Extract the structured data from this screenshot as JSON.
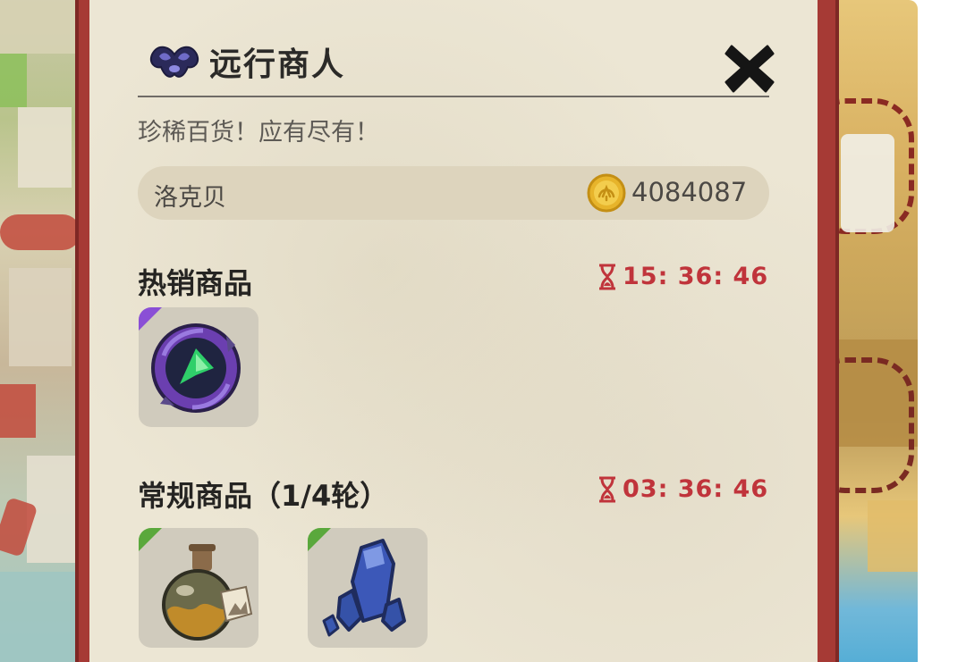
{
  "shop": {
    "title": "远行商人",
    "subtitle": "珍稀百货！应有尽有！",
    "currency": {
      "name": "洛克贝",
      "amount": "4084087",
      "icon": "coin-icon"
    },
    "close_icon": "close-icon"
  },
  "sections": {
    "hot": {
      "title": "热销商品",
      "timer": "15: 36: 46",
      "items": [
        {
          "icon": "purple-orb-icon",
          "rarity_color": "#8a4fd6"
        }
      ]
    },
    "regular": {
      "title": "常规商品（1/4轮）",
      "timer": "03: 36: 46",
      "items": [
        {
          "icon": "potion-bottle-icon",
          "rarity_color": "#5aa83c"
        },
        {
          "icon": "blue-crystal-icon",
          "rarity_color": "#5aa83c"
        }
      ]
    }
  },
  "colors": {
    "panel_frame": "#a63a35",
    "panel_bg": "#ece6d4",
    "timer_red": "#c0343b"
  }
}
